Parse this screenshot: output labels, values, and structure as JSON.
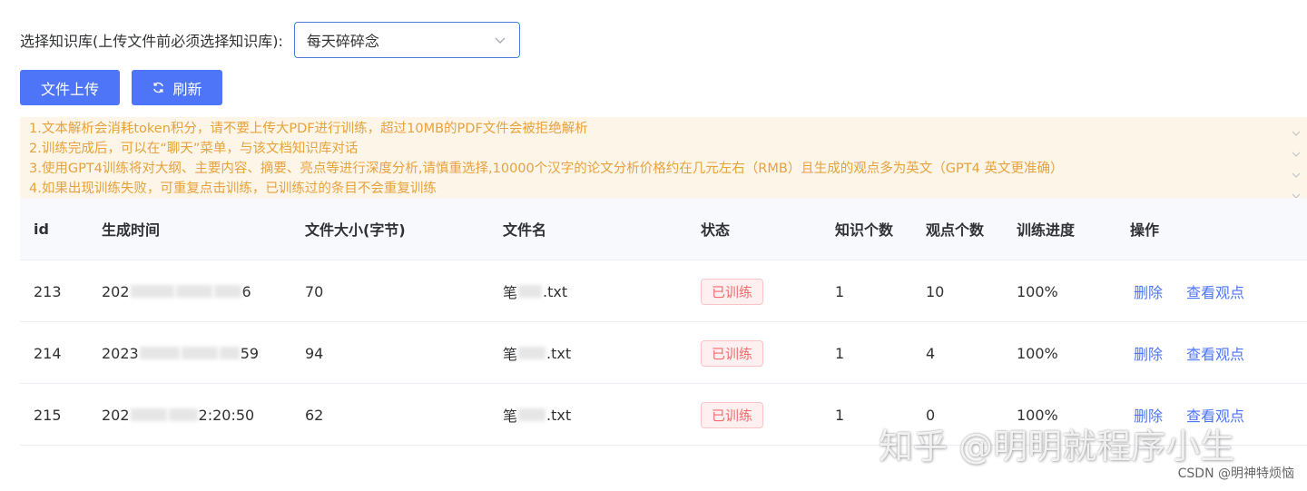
{
  "kb": {
    "label": "选择知识库(上传文件前必须选择知识库):",
    "selected": "每天碎碎念"
  },
  "buttons": {
    "upload": "文件上传",
    "refresh": "刷新"
  },
  "notice": [
    "1.文本解析会消耗token积分，请不要上传大PDF进行训练，超过10MB的PDF文件会被拒绝解析",
    "2.训练完成后，可以在“聊天”菜单，与该文档知识库对话",
    "3.使用GPT4训练将对大纲、主要内容、摘要、亮点等进行深度分析,请慎重选择,10000个汉字的论文分析价格约在几元左右（RMB）且生成的观点多为英文（GPT4 英文更准确）",
    "4.如果出现训练失败，可重复点击训练，已训练过的条目不会重复训练"
  ],
  "table": {
    "headers": [
      "id",
      "生成时间",
      "文件大小(字节)",
      "文件名",
      "状态",
      "知识个数",
      "观点个数",
      "训练进度",
      "操作"
    ],
    "rows": [
      {
        "id": "213",
        "time_prefix": "202",
        "time_suffix": "6",
        "size": "70",
        "name_prefix": "笔",
        "name_suffix": ".txt",
        "status": "已训练",
        "knowledge": "1",
        "views": "10",
        "progress": "100%",
        "op_delete": "删除",
        "op_view": "查看观点"
      },
      {
        "id": "214",
        "time_prefix": "2023",
        "time_suffix": "59",
        "size": "94",
        "name_prefix": "笔",
        "name_suffix": ".txt",
        "status": "已训练",
        "knowledge": "1",
        "views": "4",
        "progress": "100%",
        "op_delete": "删除",
        "op_view": "查看观点"
      },
      {
        "id": "215",
        "time_prefix": "202",
        "time_suffix": "2:20:50",
        "size": "62",
        "name_prefix": "笔",
        "name_suffix": ".txt",
        "status": "已训练",
        "knowledge": "1",
        "views": "0",
        "progress": "100%",
        "op_delete": "删除",
        "op_view": "查看观点"
      }
    ]
  },
  "watermark": {
    "main": "知乎 @明明就程序小生",
    "csdn": "CSDN @明神特烦恼"
  },
  "colors": {
    "primary": "#4e75f7",
    "warning_text": "#e6a23c",
    "warning_bg": "#fdf5e8",
    "danger": "#f56c6c"
  }
}
